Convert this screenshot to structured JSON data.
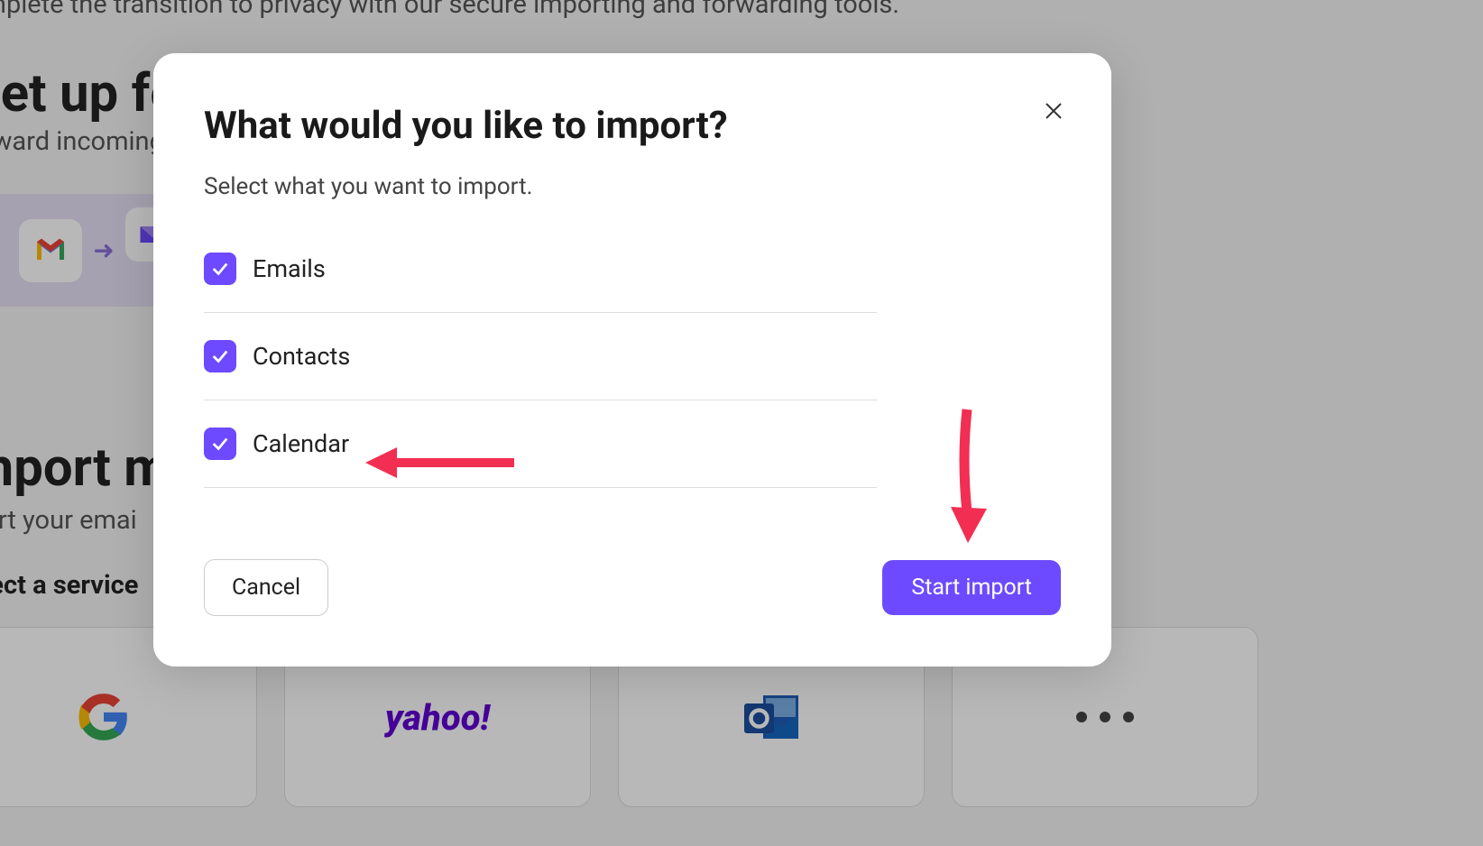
{
  "background": {
    "top_text": "omplete the transition to privacy with our secure importing and forwarding tools.",
    "setup_heading": "Set up fo",
    "forward_text": "orward incoming",
    "import_heading": "mport m",
    "import_text": "port your emai",
    "select_service": "elect a service",
    "services": [
      "google",
      "yahoo",
      "outlook",
      "more"
    ]
  },
  "modal": {
    "title": "What would you like to import?",
    "subtitle": "Select what you want to import.",
    "options": [
      {
        "label": "Emails",
        "checked": true
      },
      {
        "label": "Contacts",
        "checked": true
      },
      {
        "label": "Calendar",
        "checked": true
      }
    ],
    "cancel_label": "Cancel",
    "primary_label": "Start import"
  },
  "colors": {
    "accent": "#6d4aff",
    "annotation": "#f22e52"
  }
}
